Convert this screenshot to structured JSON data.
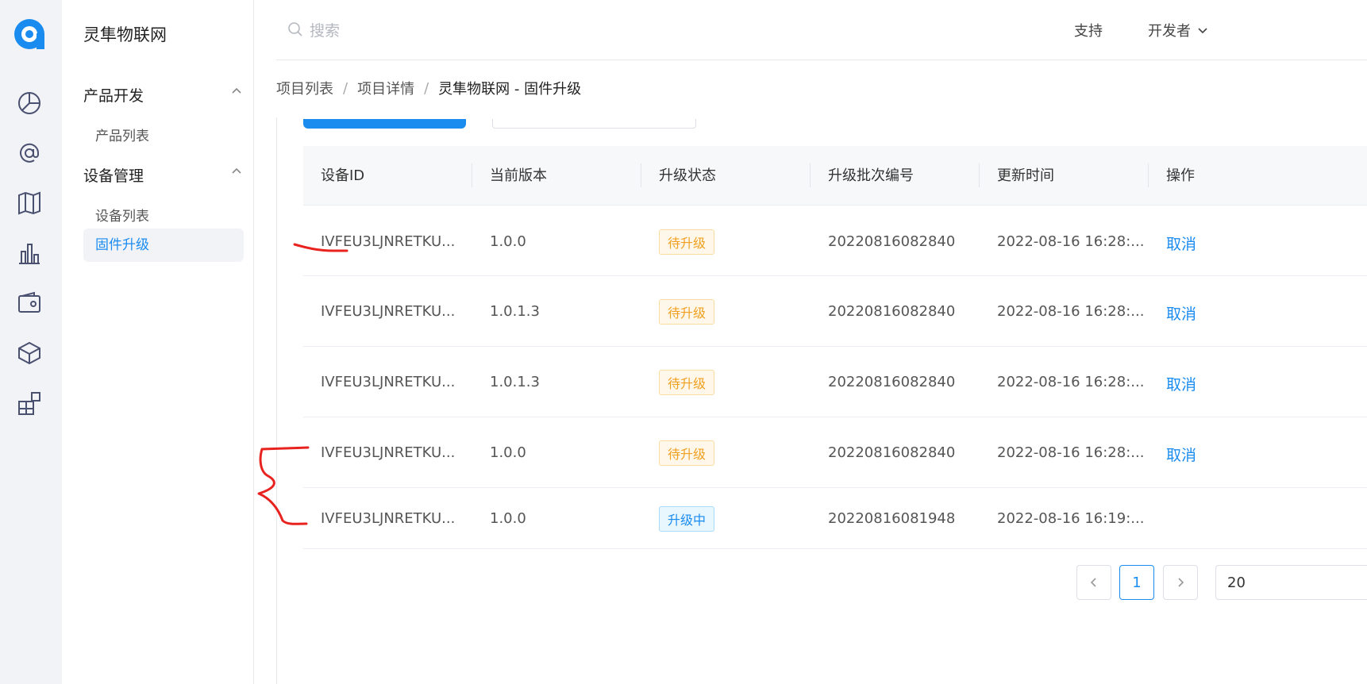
{
  "app": {
    "title": "灵隼物联网",
    "accent": "#1a8cf0"
  },
  "rail": {
    "icons": [
      "logo-icon",
      "pie-chart-icon",
      "at-sign-icon",
      "map-icon",
      "bar-chart-icon",
      "wallet-icon",
      "cube-icon",
      "grid-icon"
    ]
  },
  "sidebar": {
    "group1": "产品开发",
    "group1_item": "产品列表",
    "group2": "设备管理",
    "group2_item1": "设备列表",
    "group2_item2": "固件升级"
  },
  "header": {
    "search_placeholder": "搜索",
    "support": "支持",
    "developer": "开发者"
  },
  "breadcrumb": {
    "items": [
      "项目列表",
      "项目详情",
      "灵隼物联网 - 固件升级"
    ],
    "separator": "/"
  },
  "table": {
    "columns": [
      "设备ID",
      "当前版本",
      "升级状态",
      "升级批次编号",
      "更新时间",
      "操作"
    ],
    "rows": [
      {
        "id": "IVFEU3LJNRETKU...",
        "version": "1.0.0",
        "status": "待升级",
        "batch": "20220816082840",
        "time": "2022-08-16 16:28:...",
        "action": "取消"
      },
      {
        "id": "IVFEU3LJNRETKU...",
        "version": "1.0.1.3",
        "status": "待升级",
        "batch": "20220816082840",
        "time": "2022-08-16 16:28:...",
        "action": "取消"
      },
      {
        "id": "IVFEU3LJNRETKU...",
        "version": "1.0.1.3",
        "status": "待升级",
        "batch": "20220816082840",
        "time": "2022-08-16 16:28:...",
        "action": "取消"
      },
      {
        "id": "IVFEU3LJNRETKU...",
        "version": "1.0.0",
        "status": "待升级",
        "batch": "20220816082840",
        "time": "2022-08-16 16:28:...",
        "action": "取消"
      },
      {
        "id": "IVFEU3LJNRETKU...",
        "version": "1.0.0",
        "status": "升级中",
        "batch": "20220816081948",
        "time": "2022-08-16 16:19:...",
        "action": ""
      }
    ]
  },
  "pagination": {
    "prev": "<",
    "page": "1",
    "next": ">",
    "size": "20"
  },
  "annotation_color": "#e8231f"
}
